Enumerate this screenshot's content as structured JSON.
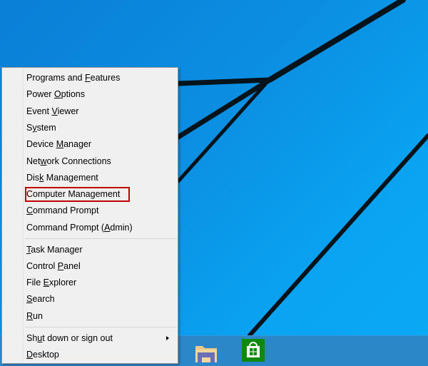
{
  "menu": {
    "groups": [
      {
        "items": [
          {
            "label": "Programs and Features",
            "access_key": "F"
          },
          {
            "label": "Power Options",
            "access_key": "O"
          },
          {
            "label": "Event Viewer",
            "access_key": "V"
          },
          {
            "label": "System",
            "access_key": "y"
          },
          {
            "label": "Device Manager",
            "access_key": "M"
          },
          {
            "label": "Network Connections",
            "access_key": "w"
          },
          {
            "label": "Disk Management",
            "access_key": "k"
          },
          {
            "label": "Computer Management",
            "access_key": "g",
            "highlighted": true
          },
          {
            "label": "Command Prompt",
            "access_key": "C"
          },
          {
            "label": "Command Prompt (Admin)",
            "access_key": "A"
          }
        ]
      },
      {
        "items": [
          {
            "label": "Task Manager",
            "access_key": "T"
          },
          {
            "label": "Control Panel",
            "access_key": "P"
          },
          {
            "label": "File Explorer",
            "access_key": "E"
          },
          {
            "label": "Search",
            "access_key": "S"
          },
          {
            "label": "Run",
            "access_key": "R"
          }
        ]
      },
      {
        "items": [
          {
            "label": "Shut down or sign out",
            "access_key": "u",
            "has_submenu": true
          },
          {
            "label": "Desktop",
            "access_key": "D"
          }
        ]
      }
    ],
    "highlight_color": "#c00000"
  },
  "taskbar": {
    "pinned": [
      {
        "name": "File Explorer",
        "icon": "folder-icon"
      },
      {
        "name": "Store",
        "icon": "store-bag-icon",
        "tile_color": "#0f8a0f"
      }
    ]
  },
  "desktop": {
    "wallpaper": "Windows light-beam lines on blue",
    "background_color": "#0a9ae9"
  }
}
